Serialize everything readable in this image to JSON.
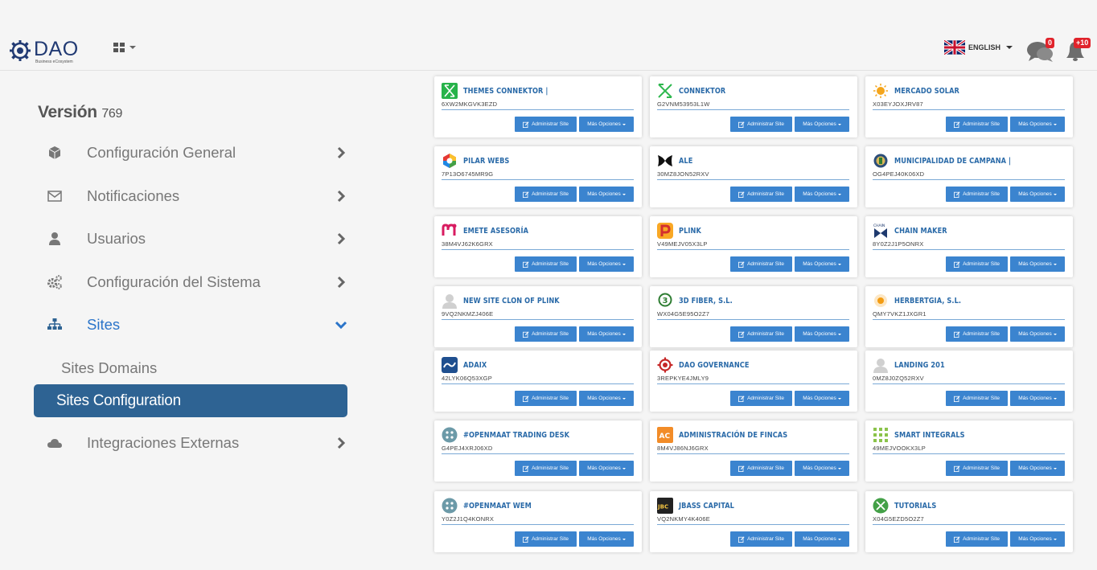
{
  "header": {
    "logo_text": "DAO",
    "logo_subtitle": "Business eCosystem",
    "language_label": "ENGLISH",
    "chat_badge": "0",
    "notifications_badge": "+10"
  },
  "sidebar": {
    "version_label": "Versión",
    "version_number": "769",
    "items": [
      {
        "label": "Configuración General",
        "icon": "cube-icon"
      },
      {
        "label": "Notificaciones",
        "icon": "envelope-icon"
      },
      {
        "label": "Usuarios",
        "icon": "user-icon"
      },
      {
        "label": "Configuración del Sistema",
        "icon": "gears-icon"
      },
      {
        "label": "Sites",
        "icon": "sitemap-icon"
      },
      {
        "label": "Integraciones Externas",
        "icon": "cloud-icon"
      }
    ],
    "sub_items": [
      "Sites Domains",
      "Sites Configuration"
    ]
  },
  "cards_common": {
    "admin_label": "Administrar Site",
    "more_label": "Más Opciones"
  },
  "cards": [
    {
      "title": "THEMES CONNEKTOR |",
      "code": "6XW2MKGVK3EZD",
      "icon": "connektor-green-icon"
    },
    {
      "title": "CONNEKTOR",
      "code": "G2VNM53953L1W",
      "icon": "connektor-outline-icon"
    },
    {
      "title": "MERCADO SOLAR",
      "code": "X03EYJOXJRV87",
      "icon": "sun-icon"
    },
    {
      "title": "PILAR WEBS",
      "code": "7P13O6745MR9G",
      "icon": "hexagon-color-icon"
    },
    {
      "title": "ALE",
      "code": "30MZ8JON52RXV",
      "icon": "ale-logo-icon"
    },
    {
      "title": "MUNICIPALIDAD DE CAMPANA |",
      "code": "OG4PEJ40K06XD",
      "icon": "municipal-crest-icon"
    },
    {
      "title": "EMETE ASESORÍA",
      "code": "38M4VJ62K6GRX",
      "icon": "emete-logo-icon"
    },
    {
      "title": "PLINK",
      "code": "V49MEJV05X3LP",
      "icon": "plink-p-icon"
    },
    {
      "title": "CHAIN MAKER",
      "code": "8Y0Z2J1P5ONRX",
      "icon": "chain-maker-icon"
    },
    {
      "title": "NEW SITE CLON OF PLINK",
      "code": "9VQ2NKMZJ406E",
      "icon": "default-user-icon"
    },
    {
      "title": "3D FIBER, S.L.",
      "code": "WX04G5E95O2Z7",
      "icon": "fiber-logo-icon"
    },
    {
      "title": "HERBERTGIA, S.L.",
      "code": "QMY7VKZ1JXGR1",
      "icon": "herbertgia-logo-icon"
    },
    {
      "title": "ADAIX",
      "code": "42LYK06Q53XGP",
      "icon": "adaix-logo-icon"
    },
    {
      "title": "DAO GOVERNANCE",
      "code": "3REPKYE4JMLY9",
      "icon": "dao-governance-icon"
    },
    {
      "title": "LANDING 201",
      "code": "0MZ8J0ZQ52RXV",
      "icon": "default-user-icon"
    },
    {
      "title": "#OPENMAAT TRADING DESK",
      "code": "G4PEJ4XRJ06XD",
      "icon": "openmaat-icon"
    },
    {
      "title": "ADMINISTRACIÓN DE FINCAS",
      "code": "8M4VJ86NJ6GRX",
      "icon": "fincas-logo-icon"
    },
    {
      "title": "SMART INTEGRALS",
      "code": "49MEJVOOKX3LP",
      "icon": "dots-grid-icon"
    },
    {
      "title": "#OPENMAAT WEM",
      "code": "Y0Z2J1Q4KONRX",
      "icon": "openmaat-icon"
    },
    {
      "title": "JBASS CAPITAL",
      "code": "VQ2NKMY4K406E",
      "icon": "jbass-logo-icon"
    },
    {
      "title": "TUTORIALS",
      "code": "X04G5EZD5O2Z7",
      "icon": "tutorials-logo-icon"
    }
  ]
}
